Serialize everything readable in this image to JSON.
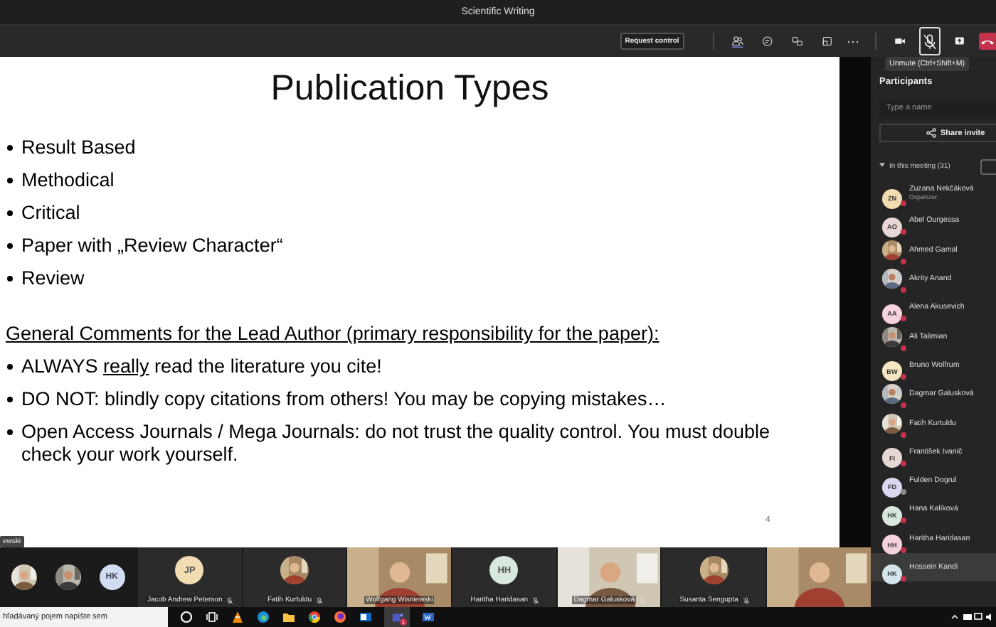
{
  "window": {
    "title": "Scientific Writing"
  },
  "toolbar": {
    "request_control": "Request control",
    "more": "⋯",
    "mic_muted": true,
    "tooltip": "Unmute (Ctrl+Shift+M)"
  },
  "slide": {
    "title": "Publication Types",
    "types": [
      "Result Based",
      "Methodical",
      "Critical",
      "Paper with „Review Character“",
      "Review"
    ],
    "heading": "General Comments for the Lead Author (primary responsibility for the paper):",
    "comments": [
      {
        "parts": [
          {
            "text": "ALWAYS "
          },
          {
            "text": "really",
            "underline": true
          },
          {
            "text": " read the literature you cite!"
          }
        ]
      },
      {
        "parts": [
          {
            "text": "DO NOT: blindly copy citations from others! You may be copying mistakes…"
          }
        ]
      },
      {
        "parts": [
          {
            "text": "Open Access Journals / Mega Journals: do not trust the quality control. You must double check your work yourself."
          }
        ]
      }
    ],
    "page_number": "4",
    "speaker_tag": "ewski"
  },
  "participants": {
    "title": "Participants",
    "search": {
      "placeholder": "Type a name"
    },
    "share_invite": "Share invite",
    "section": {
      "label": "In this meeting (31)",
      "expanded": true
    },
    "people": [
      {
        "name": "Zuzana Nekčáková",
        "role": "Organizer",
        "kind": "initials",
        "initials": "ZN",
        "color": "#c4314b",
        "selected": false
      },
      {
        "name": "Abel Ourgessa",
        "kind": "initials",
        "initials": "AO",
        "color": "#c4314b",
        "selected": false
      },
      {
        "name": "Ahmed Gamal",
        "kind": "picture",
        "color": "#c4314b",
        "selected": false
      },
      {
        "name": "Akrity Anand",
        "kind": "picture",
        "color": "#c4314b",
        "selected": false
      },
      {
        "name": "Alena Akusevich",
        "kind": "initials",
        "initials": "AA",
        "color": "#c4314b",
        "selected": false
      },
      {
        "name": "Ali Talimian",
        "kind": "picture",
        "color": "#c4314b",
        "selected": false
      },
      {
        "name": "Bruno Wolfrum",
        "kind": "initials",
        "initials": "BW",
        "color": "#c4314b",
        "selected": false
      },
      {
        "name": "Dagmar Galusková",
        "kind": "picture",
        "color": "#c4314b",
        "selected": false
      },
      {
        "name": "Fatih Kurtuldu",
        "kind": "picture",
        "color": "#c4314b",
        "selected": false
      },
      {
        "name": "František Ivanič",
        "kind": "initials",
        "initials": "FI",
        "color": "#c4314b",
        "selected": false
      },
      {
        "name": "Fulden Dogrul",
        "kind": "initials",
        "initials": "FD",
        "color": "#8a8886",
        "selected": false
      },
      {
        "name": "Hana Kalíková",
        "kind": "initials",
        "initials": "HK",
        "color": "#c4314b",
        "selected": false
      },
      {
        "name": "Haritha Haridasan",
        "kind": "initials",
        "initials": "HH",
        "color": "#c4314b",
        "selected": false
      },
      {
        "name": "Hossein Kandi",
        "kind": "initials",
        "initials": "HK",
        "color": "#c4314b",
        "selected": true
      }
    ]
  },
  "gallery": {
    "small": [
      {
        "kind": "picture"
      },
      {
        "kind": "picture"
      },
      {
        "kind": "initials",
        "initials": "HK"
      }
    ],
    "tiles": [
      {
        "name": "Jacob Andrew Peterson",
        "kind": "initials",
        "initials": "JP",
        "muted": true
      },
      {
        "name": "Fatih Kurtuldu",
        "kind": "avatar",
        "muted": true
      },
      {
        "name": "Wolfgang Wisniewski",
        "kind": "video",
        "muted": false
      },
      {
        "name": "Haritha Haridasan",
        "kind": "initials",
        "initials": "HH",
        "muted": true
      },
      {
        "name": "Dagmar Galusková",
        "kind": "video",
        "muted": true
      },
      {
        "name": "Susanta Sengupta",
        "kind": "avatar",
        "muted": true
      },
      {
        "kind": "video"
      }
    ]
  },
  "taskbar": {
    "search": {
      "placeholder": "hľadávaný pojem napíšte sem"
    },
    "teams_badge": "1"
  }
}
